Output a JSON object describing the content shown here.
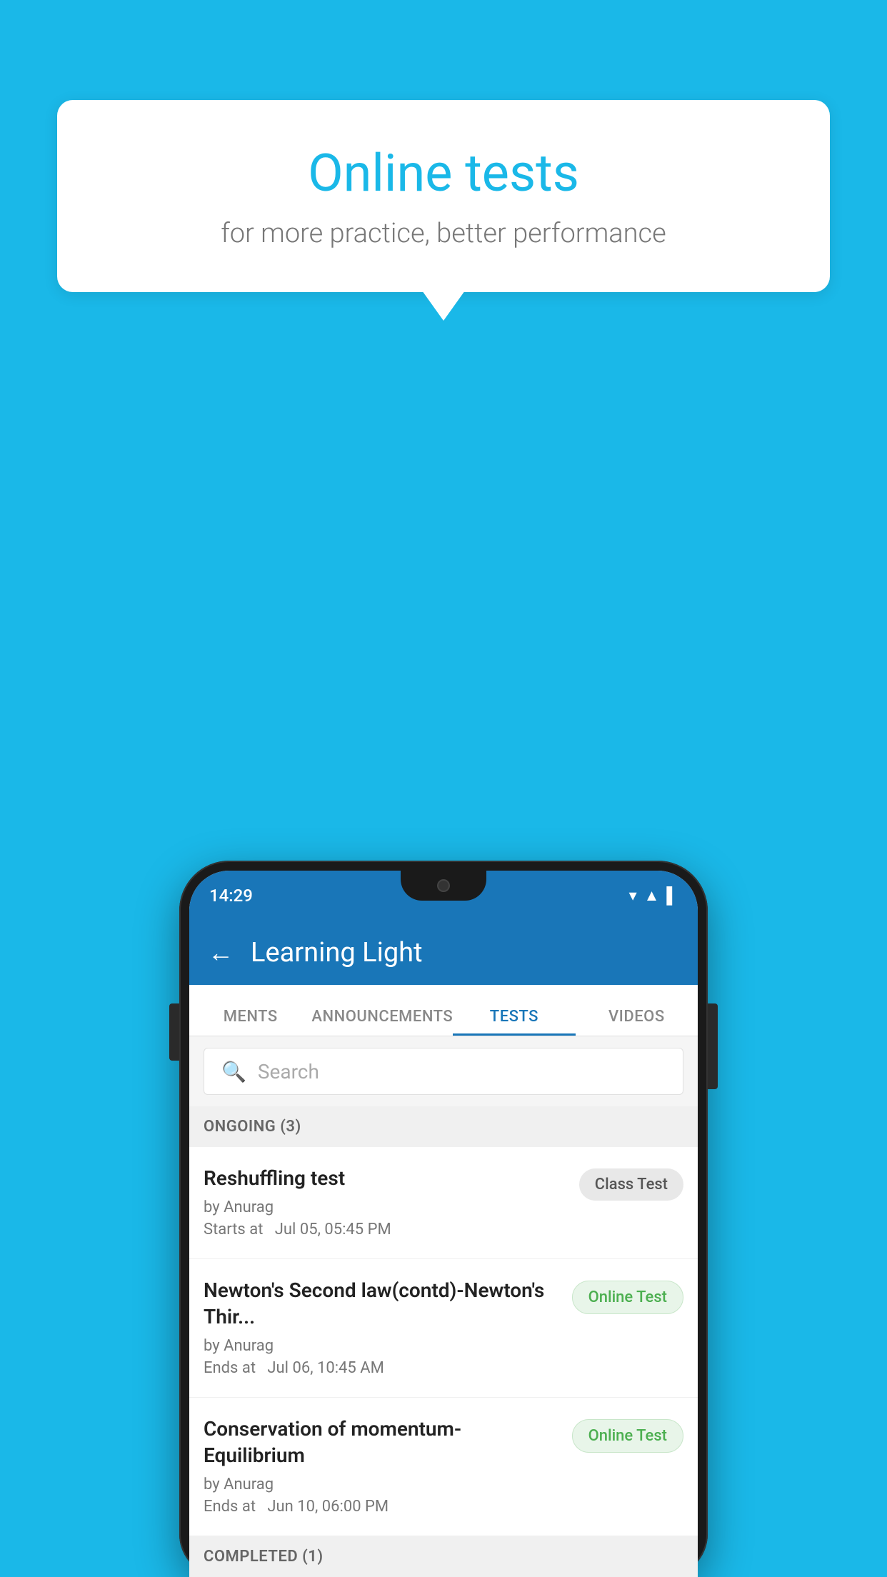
{
  "background_color": "#1ab8e8",
  "speech_bubble": {
    "title": "Online tests",
    "subtitle": "for more practice, better performance"
  },
  "phone": {
    "status_bar": {
      "time": "14:29",
      "icons": [
        "wifi",
        "signal",
        "battery"
      ]
    },
    "app_bar": {
      "title": "Learning Light",
      "back_label": "←"
    },
    "tabs": [
      {
        "label": "MENTS",
        "active": false
      },
      {
        "label": "ANNOUNCEMENTS",
        "active": false
      },
      {
        "label": "TESTS",
        "active": true
      },
      {
        "label": "VIDEOS",
        "active": false
      }
    ],
    "search": {
      "placeholder": "Search",
      "icon": "🔍"
    },
    "sections": [
      {
        "header": "ONGOING (3)",
        "items": [
          {
            "name": "Reshuffling test",
            "by": "by Anurag",
            "time": "Starts at  Jul 05, 05:45 PM",
            "badge": "Class Test",
            "badge_type": "class"
          },
          {
            "name": "Newton's Second law(contd)-Newton's Thir...",
            "by": "by Anurag",
            "time": "Ends at  Jul 06, 10:45 AM",
            "badge": "Online Test",
            "badge_type": "online"
          },
          {
            "name": "Conservation of momentum-Equilibrium",
            "by": "by Anurag",
            "time": "Ends at  Jun 10, 06:00 PM",
            "badge": "Online Test",
            "badge_type": "online"
          }
        ]
      },
      {
        "header": "COMPLETED (1)",
        "items": []
      }
    ]
  }
}
